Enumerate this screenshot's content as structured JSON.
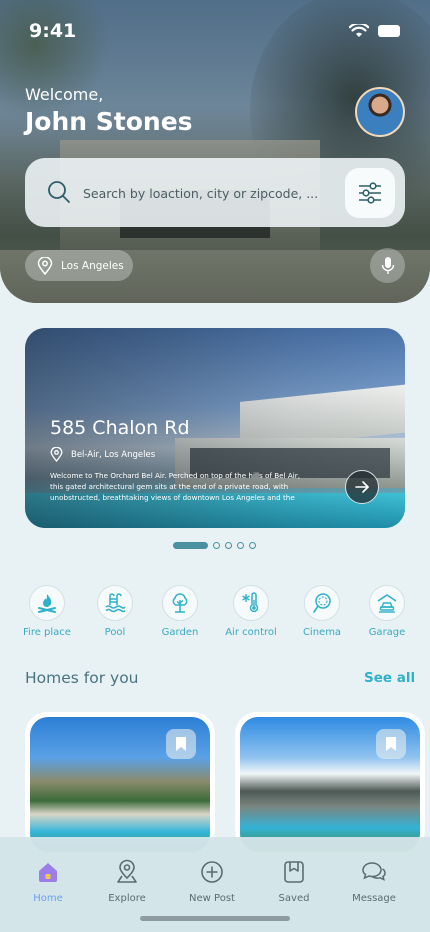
{
  "status_bar": {
    "time": "9:41"
  },
  "header": {
    "welcome": "Welcome,",
    "username": "John Stones"
  },
  "search": {
    "placeholder": "Search by loaction, city or zipcode, ..."
  },
  "location": {
    "label": "Los Angeles"
  },
  "featured": {
    "title": "585 Chalon Rd",
    "location": "Bel-Air, Los Angeles",
    "description": "Welcome to The Orchard Bel Air. Perched on top of the hills of Bel Air, this gated architectural gem sits at the end of a private road, with unobstructed, breathtaking views of downtown Los Angeles and the Cali..."
  },
  "carousel": {
    "pages": 5,
    "active_index": 0
  },
  "amenities": [
    {
      "label": "Fire place",
      "icon": "fireplace-icon"
    },
    {
      "label": "Pool",
      "icon": "pool-icon"
    },
    {
      "label": "Garden",
      "icon": "garden-tree-icon"
    },
    {
      "label": "Air control",
      "icon": "thermometer-icon"
    },
    {
      "label": "Cinema",
      "icon": "cinema-icon"
    },
    {
      "label": "Garage",
      "icon": "garage-icon"
    }
  ],
  "homes": {
    "title": "Homes for you",
    "see_all": "See all"
  },
  "tabs": [
    {
      "label": "Home",
      "icon": "home-icon",
      "active": true
    },
    {
      "label": "Explore",
      "icon": "explore-pin-icon",
      "active": false
    },
    {
      "label": "New Post",
      "icon": "plus-circle-icon",
      "active": false
    },
    {
      "label": "Saved",
      "icon": "bookmark-icon",
      "active": false
    },
    {
      "label": "Message",
      "icon": "chat-bubbles-icon",
      "active": false
    }
  ],
  "colors": {
    "accent": "#2fb1c9",
    "active_tab": "#6a9ff0",
    "background": "#e8f1f3"
  }
}
